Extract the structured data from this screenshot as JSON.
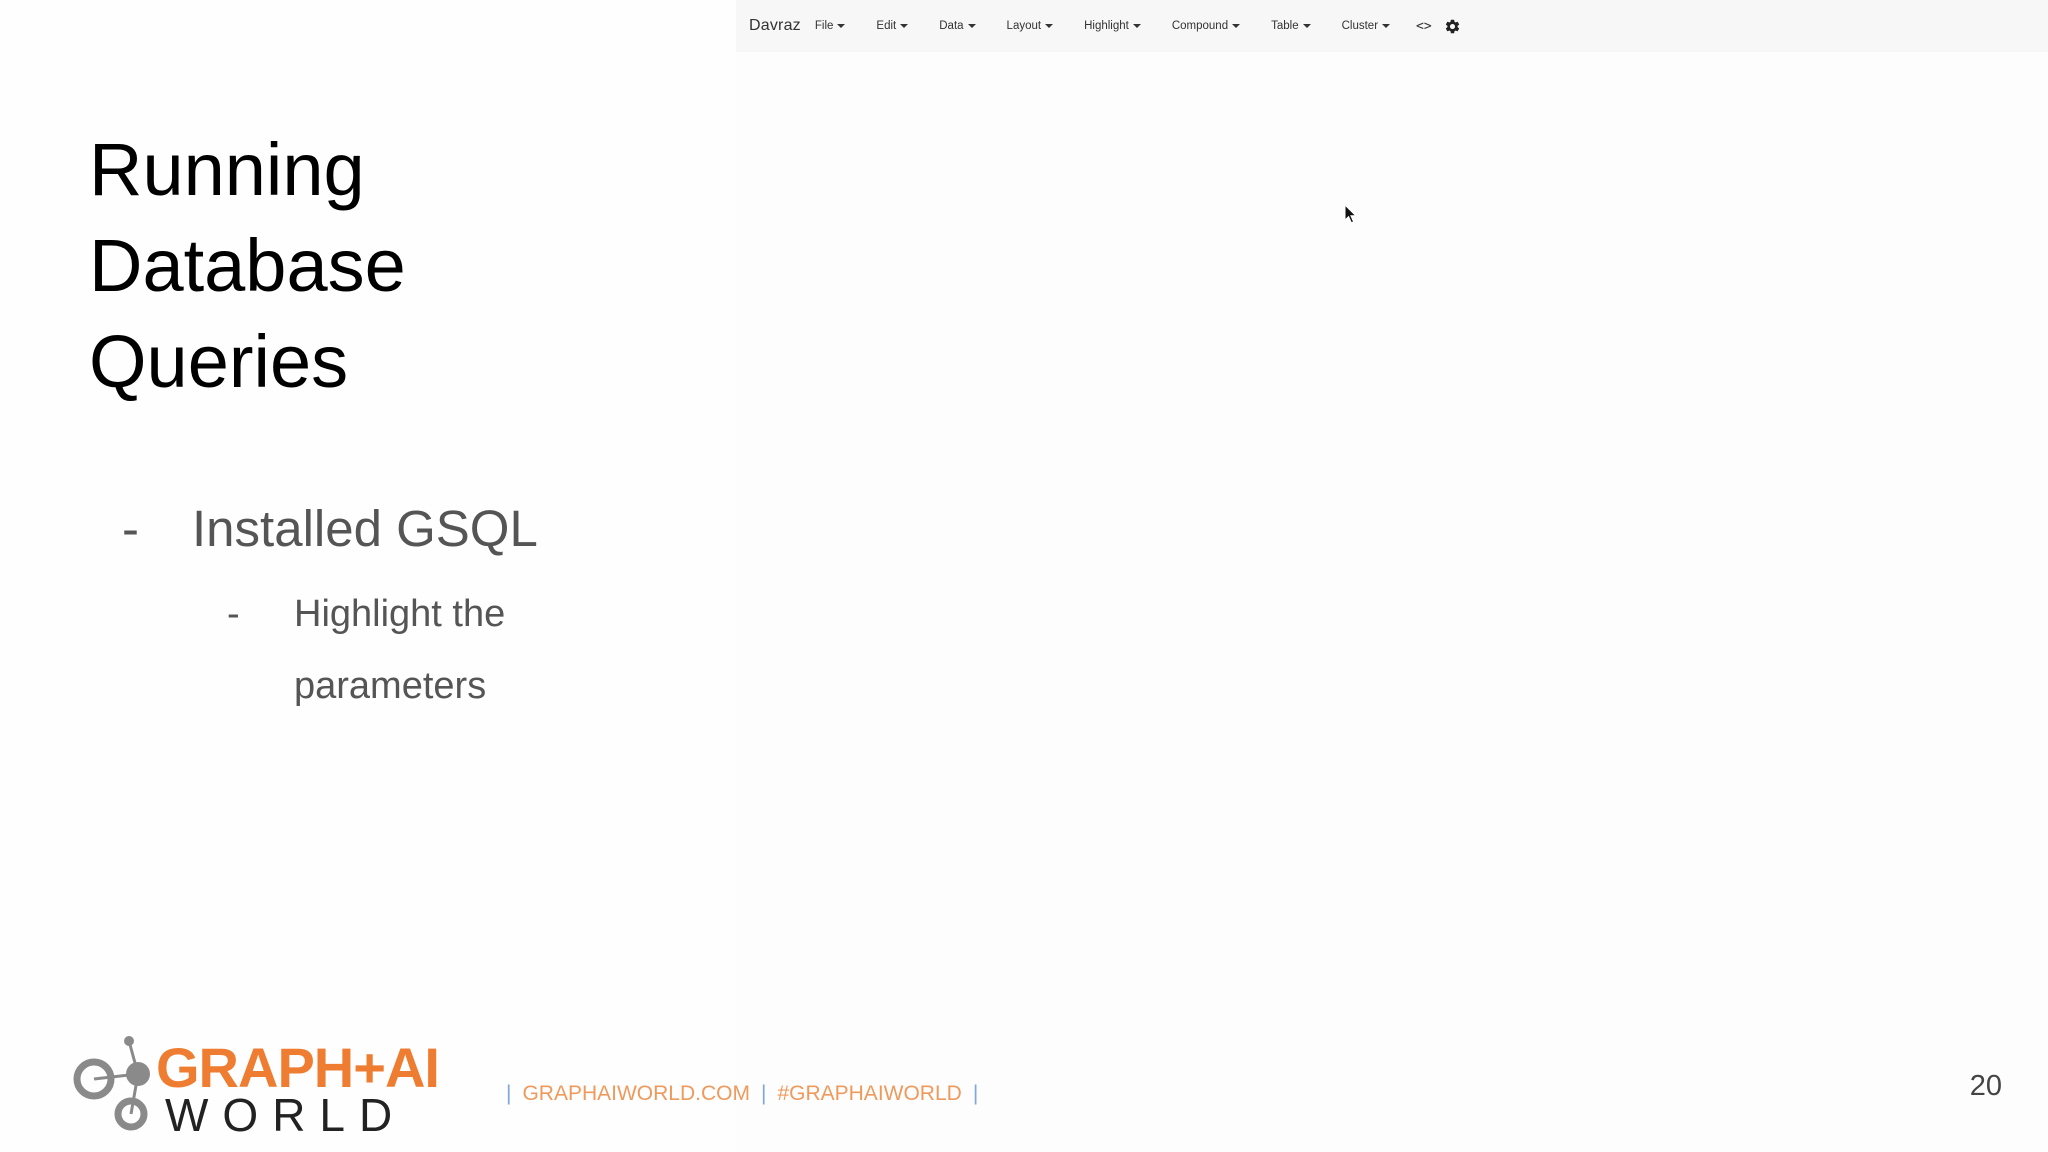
{
  "app": {
    "brand": "Davraz",
    "menu": [
      {
        "label": "File"
      },
      {
        "label": "Edit"
      },
      {
        "label": "Data"
      },
      {
        "label": "Layout"
      },
      {
        "label": "Highlight"
      },
      {
        "label": "Compound"
      },
      {
        "label": "Table"
      },
      {
        "label": "Cluster"
      }
    ],
    "code_toggle": "<>"
  },
  "slide": {
    "title_lines": [
      "Running",
      "Database",
      "Queries"
    ],
    "bullet": {
      "dash": "-",
      "text": "Installed GSQL"
    },
    "sub_bullet": {
      "dash": "-",
      "lines": [
        "Highlight the",
        "parameters"
      ]
    },
    "logo": {
      "top": "GRAPH+AI",
      "bottom": "WORLD"
    },
    "footer": {
      "sep": "|",
      "site": "GRAPHAIWORLD.COM",
      "hashtag": "#GRAPHAIWORLD"
    },
    "page_number": "20"
  },
  "colors": {
    "brand_orange": "#ee7d31",
    "footer_text": "#ee9a5d",
    "footer_separator": "#7fa8d6",
    "navbar_bg": "#f7f7f7"
  }
}
